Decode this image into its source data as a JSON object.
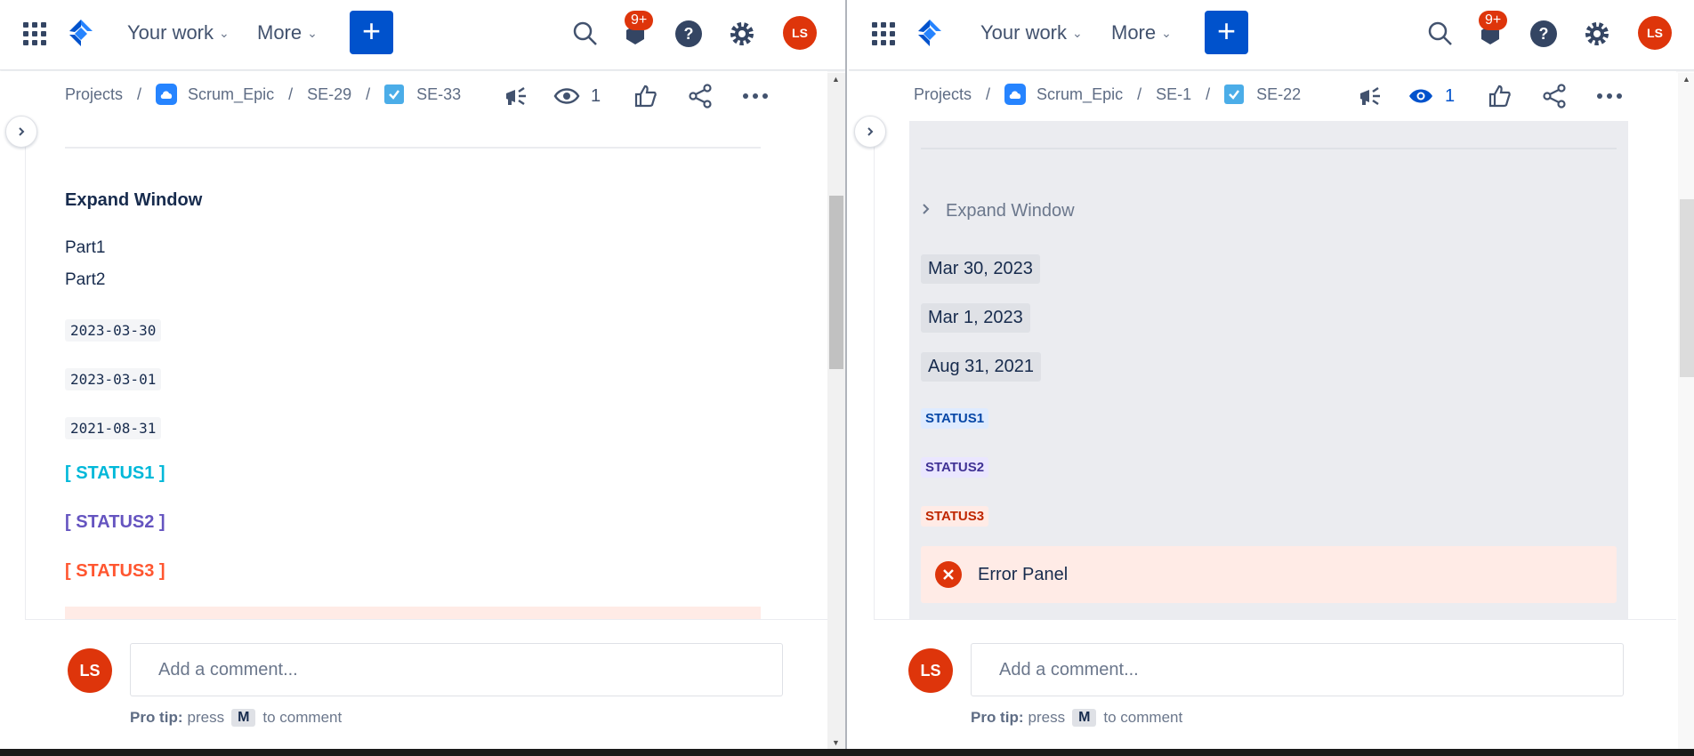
{
  "topbar": {
    "your_work": "Your work",
    "more": "More",
    "create": "+",
    "notifications_badge": "9+",
    "avatar_initials": "LS"
  },
  "left": {
    "breadcrumb": {
      "projects": "Projects",
      "project": "Scrum_Epic",
      "parent": "SE-29",
      "issue": "SE-33"
    },
    "watchers": "1",
    "expand_title": "Expand Window",
    "lines": [
      "Part1",
      "Part2"
    ],
    "dates": [
      "2023-03-30",
      "2023-03-01",
      "2021-08-31"
    ],
    "statuses": [
      "[ STATUS1 ]",
      "[ STATUS2 ]",
      "[ STATUS3 ]"
    ],
    "status_colors": [
      "#00b8d9",
      "#6554c0",
      "#ff5630"
    ]
  },
  "right": {
    "breadcrumb": {
      "projects": "Projects",
      "project": "Scrum_Epic",
      "parent": "SE-1",
      "issue": "SE-22"
    },
    "watchers": "1",
    "expand_title": "Expand Window",
    "dates": [
      "Mar 30, 2023",
      "Mar 1, 2023",
      "Aug 31, 2021"
    ],
    "statuses": [
      "STATUS1",
      "STATUS2",
      "STATUS3"
    ],
    "status_colors": [
      {
        "bg": "#deebff",
        "fg": "#0747a6"
      },
      {
        "bg": "#eae6ff",
        "fg": "#403294"
      },
      {
        "bg": "#ffebe6",
        "fg": "#bf2600"
      }
    ],
    "error_panel": "Error Panel"
  },
  "comment": {
    "avatar_initials": "LS",
    "placeholder": "Add a comment...",
    "protip_label": "Pro tip:",
    "protip_press": "press",
    "protip_key": "M",
    "protip_tail": "to comment"
  },
  "colors": {
    "accent": "#0052cc",
    "avatar": "#de350b"
  }
}
